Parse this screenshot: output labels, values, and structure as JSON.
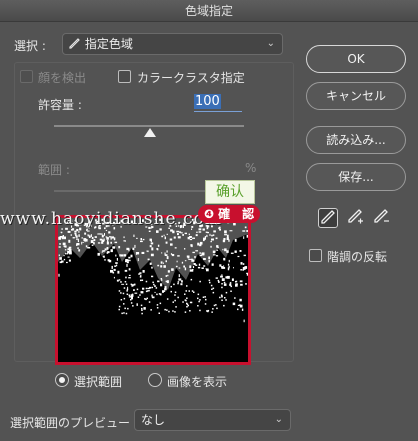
{
  "window": {
    "title": "色域指定"
  },
  "selection": {
    "label": "選択 :",
    "value": "指定色域",
    "icon": "eyedropper-icon"
  },
  "options": {
    "detect_faces": "顔を検出",
    "localized_clusters": "カラークラスタ指定"
  },
  "tolerance": {
    "label": "許容量 :",
    "value": "100"
  },
  "range": {
    "label": "範囲 :",
    "unit": "%"
  },
  "buttons": {
    "ok": "OK",
    "cancel": "キャンセル",
    "load": "読み込み...",
    "save": "保存..."
  },
  "invert": {
    "label": "階調の反転"
  },
  "view": {
    "selection_option": "選択範囲",
    "image_option": "画像を表示",
    "selected": "selection"
  },
  "preview_select": {
    "label": "選択範囲のプレビュー :",
    "value": "なし"
  },
  "annotations": {
    "watermark": "www.haoyidianshe.com",
    "confirm_tooltip": "确认",
    "confirm_badge": "❹ 確　認"
  },
  "colors": {
    "dialog_bg": "#535353",
    "highlight_red": "#c8102e",
    "accent_blue": "#3b6fb6"
  }
}
